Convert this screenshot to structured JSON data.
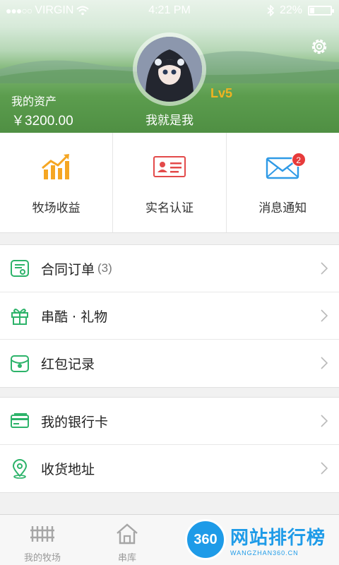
{
  "status_bar": {
    "carrier": "VIRGIN",
    "time": "4:21 PM",
    "battery": "22%",
    "battery_level": 0.22
  },
  "profile": {
    "asset_label": "我的资产",
    "asset_value": "￥3200.00",
    "nickname": "我就是我",
    "level": "Lv5"
  },
  "quick_actions": [
    {
      "label": "牧场收益",
      "icon": "chart-up-icon"
    },
    {
      "label": "实名认证",
      "icon": "id-card-icon"
    },
    {
      "label": "消息通知",
      "icon": "envelope-icon",
      "badge": "2"
    }
  ],
  "menu_group_1": [
    {
      "label": "合同订单",
      "count": "(3)",
      "icon": "contract-icon"
    },
    {
      "label": "串酷 · 礼物",
      "icon": "gift-icon"
    },
    {
      "label": "红包记录",
      "icon": "red-packet-icon"
    }
  ],
  "menu_group_2": [
    {
      "label": "我的银行卡",
      "icon": "bank-card-icon"
    },
    {
      "label": "收货地址",
      "icon": "location-icon"
    }
  ],
  "tab_bar": [
    {
      "label": "我的牧场",
      "icon": "fence-icon"
    },
    {
      "label": "串库",
      "icon": "house-icon"
    }
  ],
  "watermark": {
    "logo": "360",
    "main": "网站排行榜",
    "sub": "WANGZHAN360.CN"
  },
  "colors": {
    "accent_green": "#2db36a",
    "badge_red": "#e73b3b",
    "level_gold": "#f0b321",
    "chart_orange": "#f5a623",
    "envelope_blue": "#2f9ae6"
  }
}
